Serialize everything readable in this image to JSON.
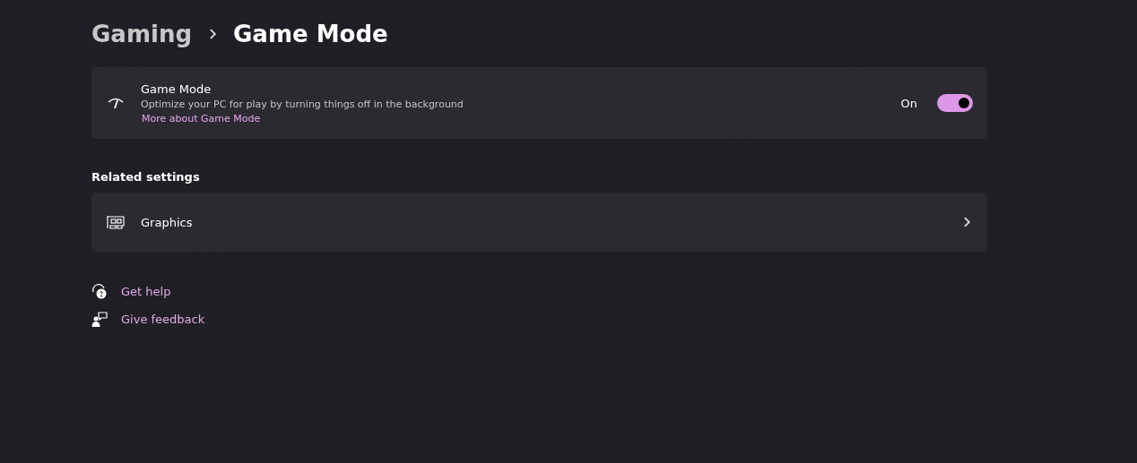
{
  "breadcrumb": [
    {
      "label": "Gaming"
    },
    {
      "label": "Game Mode"
    }
  ],
  "game_mode": {
    "title": "Game Mode",
    "description": "Optimize your PC for play by turning things off in the background",
    "link": "More about Game Mode",
    "toggle_label": "On",
    "on": true
  },
  "related_settings": {
    "heading": "Related settings",
    "items": [
      {
        "label": "Graphics"
      }
    ]
  },
  "help_links": [
    {
      "kind": "help",
      "label": "Get help"
    },
    {
      "kind": "feedback",
      "label": "Give feedback"
    }
  ]
}
